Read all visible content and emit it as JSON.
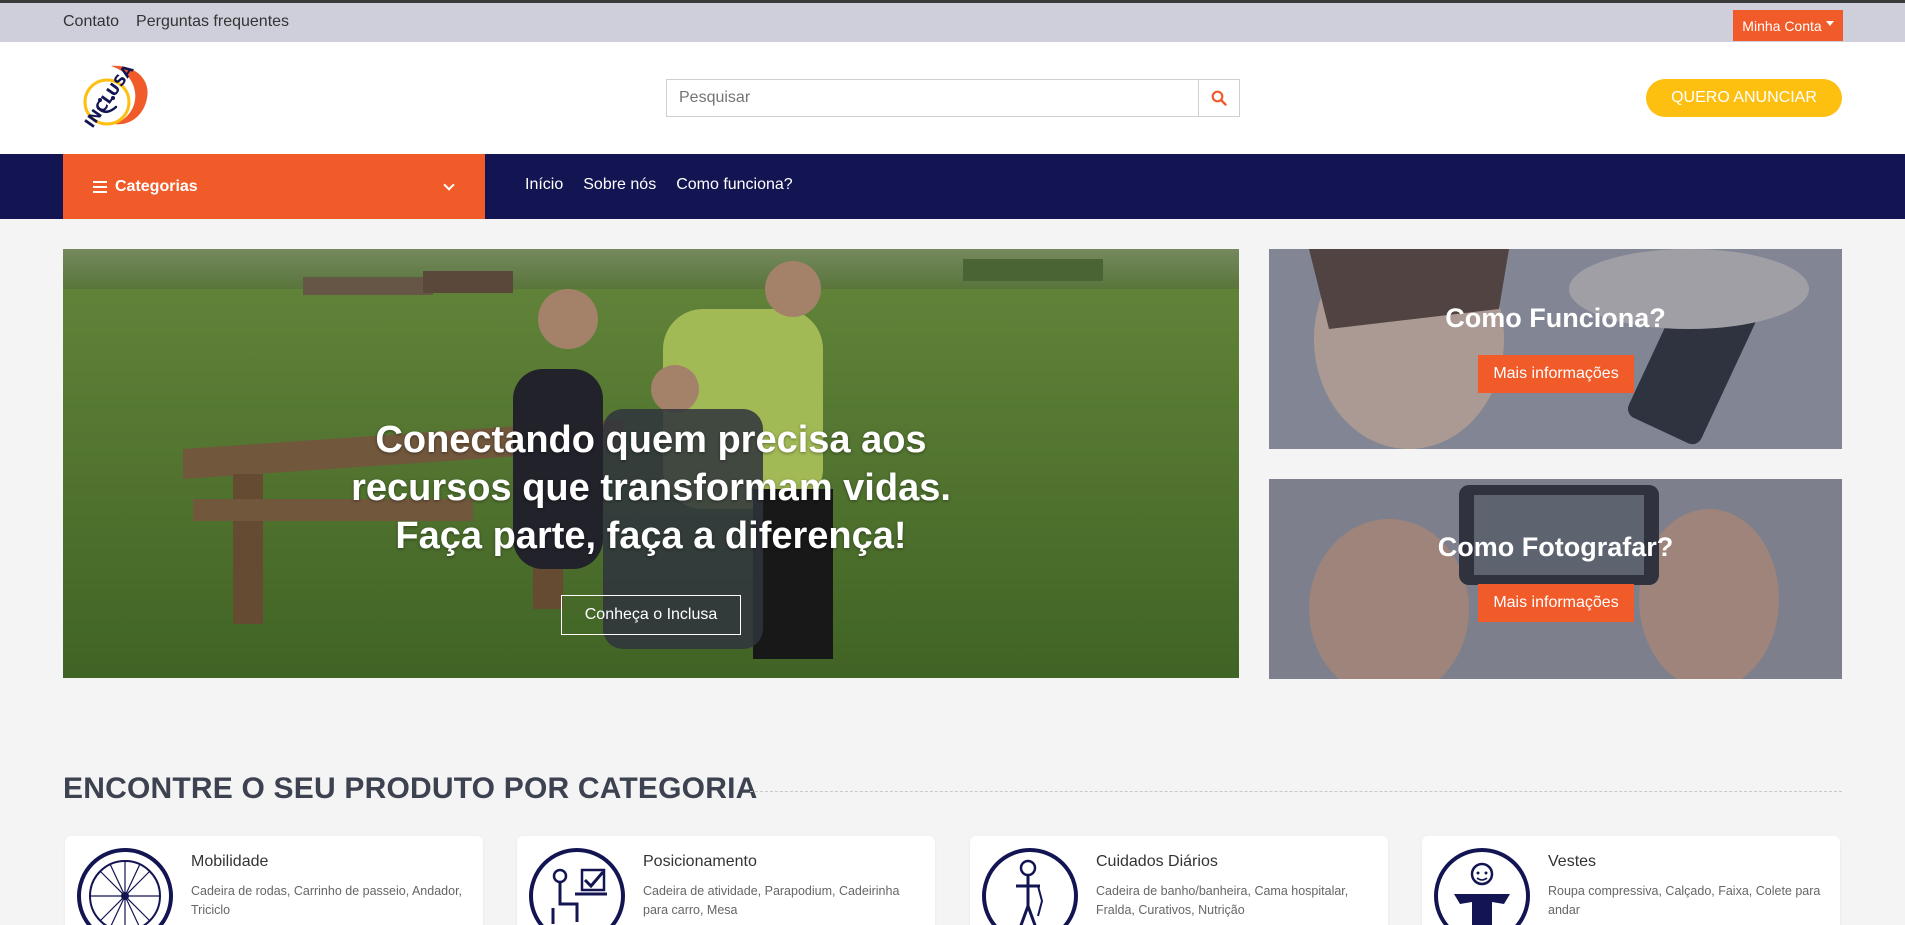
{
  "topbar": {
    "links": [
      "Contato",
      "Perguntas frequentes"
    ],
    "account_label": "Minha Conta"
  },
  "header": {
    "logo_text": "INCLUSA",
    "search_placeholder": "Pesquisar",
    "announce_label": "QUERO ANUNCIAR"
  },
  "nav": {
    "categories_label": "Categorias",
    "links": [
      "Início",
      "Sobre nós",
      "Como funciona?"
    ]
  },
  "hero": {
    "title_lines": [
      "Conectando quem precisa aos",
      "recursos que transformam vidas.",
      "Faça parte, faça a diferença!"
    ],
    "cta_label": "Conheça o Inclusa"
  },
  "promos": [
    {
      "title": "Como Funciona?",
      "button": "Mais informações"
    },
    {
      "title": "Como Fotografar?",
      "button": "Mais informações"
    }
  ],
  "categories_section": {
    "title": "ENCONTRE O SEU PRODUTO POR CATEGORIA",
    "items": [
      {
        "name": "Mobilidade",
        "desc": "Cadeira de rodas, Carrinho de passeio, Andador, Triciclo",
        "icon": "wheel-icon"
      },
      {
        "name": "Posicionamento",
        "desc": "Cadeira de atividade, Parapodium, Cadeirinha para carro, Mesa",
        "icon": "seated-person-icon"
      },
      {
        "name": "Cuidados Diários",
        "desc": "Cadeira de banho/banheira, Cama hospitalar, Fralda, Curativos, Nutrição",
        "icon": "standing-person-icon"
      },
      {
        "name": "Vestes",
        "desc": "Roupa compressiva, Calçado, Faixa, Colete para andar",
        "icon": "clothing-person-icon"
      }
    ]
  },
  "colors": {
    "orange": "#f15a29",
    "navy": "#131552",
    "yellow": "#fdbf10"
  }
}
